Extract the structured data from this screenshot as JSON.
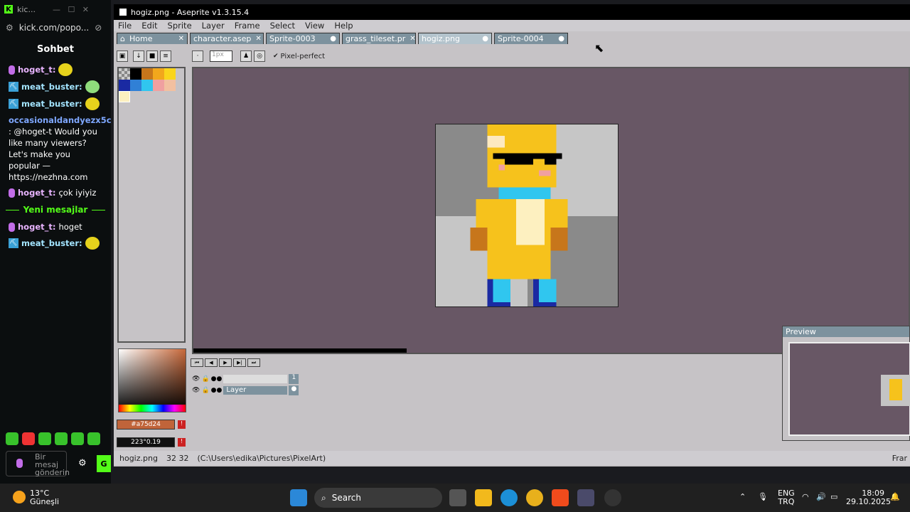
{
  "kick": {
    "window_title": "kic...",
    "url": "kick.com/popo...",
    "chat_title": "Sohbet",
    "messages": [
      {
        "user": "hoget_t:",
        "text": ""
      },
      {
        "user": "meat_buster:",
        "text": ""
      },
      {
        "user": "meat_buster:",
        "text": ""
      },
      {
        "user": "occasionaldandyezx5ciqa",
        "text": ": @hoget-t Would you like many viewers? Let's make you popular — https://nezhna.com"
      },
      {
        "user": "hoget_t:",
        "text": "çok iyiyiz"
      }
    ],
    "new_messages": "Yeni mesajlar",
    "messages_after": [
      {
        "user": "hoget_t:",
        "text": "hoget"
      },
      {
        "user": "meat_buster:",
        "text": ""
      }
    ],
    "input_placeholder": "Bir mesaj gönderin"
  },
  "aseprite": {
    "title": "hogiz.png - Aseprite v1.3.15.4",
    "menu": [
      "File",
      "Edit",
      "Sprite",
      "Layer",
      "Frame",
      "Select",
      "View",
      "Help"
    ],
    "tabs": [
      "Home",
      "character.asep",
      "Sprite-0003",
      "grass_tileset.pr",
      "hogiz.png",
      "Sprite-0004"
    ],
    "active_tab": "hogiz.png",
    "brush_size": "1px",
    "pixel_perfect_label": "Pixel-perfect",
    "layer_name": "Layer",
    "frame_number": "1",
    "color_hex": "#a75d24",
    "color_hsv": "223°0.19",
    "preview_title": "Preview",
    "status_file": "hogiz.png",
    "status_size": "32 32",
    "status_path": "(C:\\Users\\edika\\Pictures\\PixelArt)",
    "status_right": "Frar"
  },
  "taskbar": {
    "weather_temp": "13°C",
    "weather_desc": "Güneşli",
    "search_label": "Search",
    "lang1": "ENG",
    "lang2": "TRQ",
    "time": "18:09",
    "date": "29.10.2025"
  }
}
